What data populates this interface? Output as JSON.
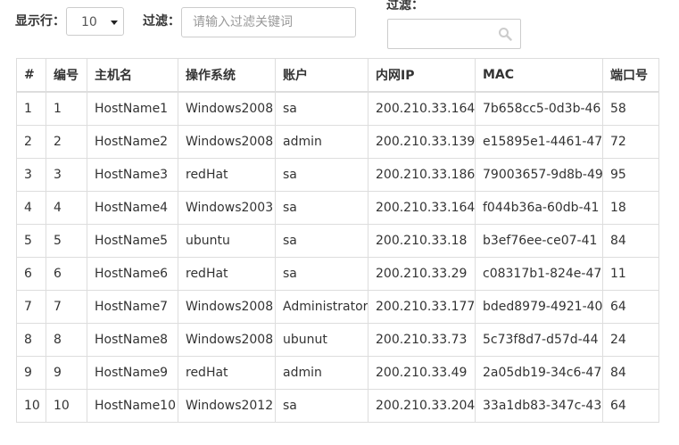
{
  "toolbar": {
    "rows_label": "显示行：",
    "rows_value": "10",
    "filter_label": "过滤：",
    "filter_placeholder": "请输入过滤关键词",
    "filter2_label": "过滤："
  },
  "table": {
    "columns": [
      "#",
      "编号",
      "主机名",
      "操作系统",
      "账户",
      "内网IP",
      "MAC",
      "端口号"
    ],
    "rows": [
      [
        "1",
        "1",
        "HostName1",
        "Windows2008",
        "sa",
        "200.210.33.164",
        "7b658cc5-0d3b-46",
        "58"
      ],
      [
        "2",
        "2",
        "HostName2",
        "Windows2008",
        "admin",
        "200.210.33.139",
        "e15895e1-4461-47",
        "72"
      ],
      [
        "3",
        "3",
        "HostName3",
        "redHat",
        "sa",
        "200.210.33.186",
        "79003657-9d8b-49",
        "95"
      ],
      [
        "4",
        "4",
        "HostName4",
        "Windows2003",
        "sa",
        "200.210.33.164",
        "f044b36a-60db-41",
        "18"
      ],
      [
        "5",
        "5",
        "HostName5",
        "ubuntu",
        "sa",
        "200.210.33.18",
        "b3ef76ee-ce07-41",
        "84"
      ],
      [
        "6",
        "6",
        "HostName6",
        "redHat",
        "sa",
        "200.210.33.29",
        "c08317b1-824e-47",
        "11"
      ],
      [
        "7",
        "7",
        "HostName7",
        "Windows2008",
        "Administrator",
        "200.210.33.177",
        "bded8979-4921-40",
        "64"
      ],
      [
        "8",
        "8",
        "HostName8",
        "Windows2008",
        "ubunut",
        "200.210.33.73",
        "5c73f8d7-d57d-44",
        "24"
      ],
      [
        "9",
        "9",
        "HostName9",
        "redHat",
        "admin",
        "200.210.33.49",
        "2a05db19-34c6-47",
        "84"
      ],
      [
        "10",
        "10",
        "HostName10",
        "Windows2012",
        "sa",
        "200.210.33.204",
        "33a1db83-347c-43",
        "64"
      ]
    ]
  },
  "icons": {
    "search": "search-icon",
    "select_caret": "caret-down-icon"
  }
}
